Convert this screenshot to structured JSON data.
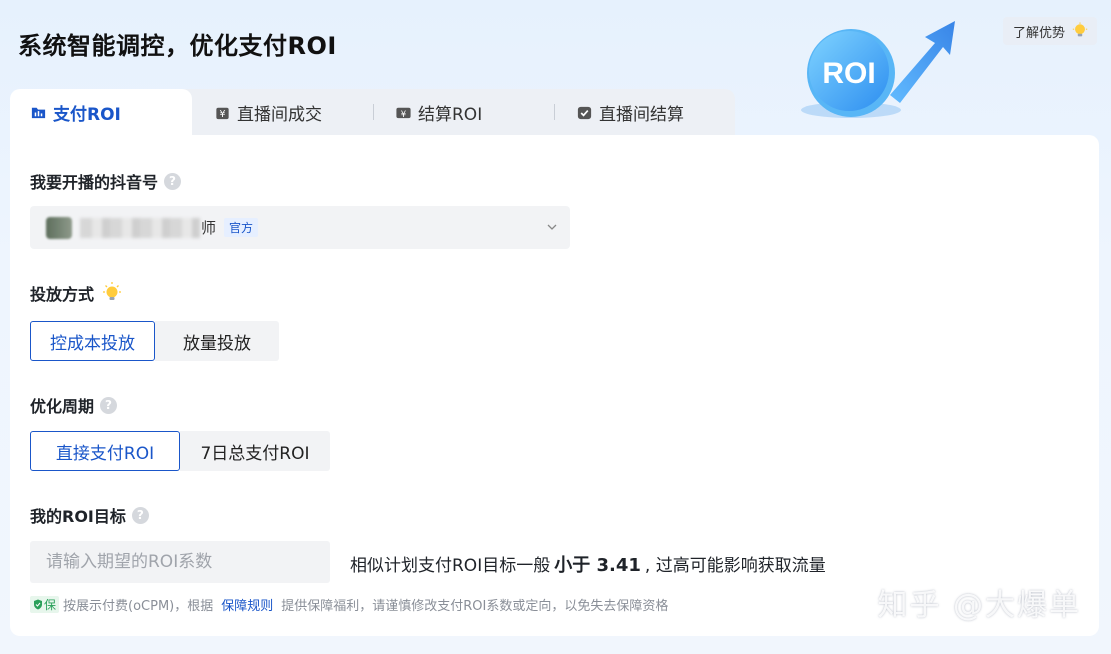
{
  "header": {
    "title": "系统智能调控，优化支付ROI",
    "learn_button": "了解优势",
    "deco_text": "ROI"
  },
  "tabs": [
    {
      "label": "支付ROI",
      "icon": "chart-icon",
      "active": true
    },
    {
      "label": "直播间成交",
      "icon": "bag-icon",
      "active": false
    },
    {
      "label": "结算ROI",
      "icon": "wallet-icon",
      "active": false
    },
    {
      "label": "直播间结算",
      "icon": "check-icon",
      "active": false
    }
  ],
  "account": {
    "label": "我要开播的抖音号",
    "name_suffix": "师",
    "official_tag": "官方"
  },
  "delivery": {
    "label": "投放方式",
    "options": [
      "控成本投放",
      "放量投放"
    ],
    "selected": "控成本投放"
  },
  "period": {
    "label": "优化周期",
    "options": [
      "直接支付ROI",
      "7日总支付ROI"
    ],
    "selected": "直接支付ROI"
  },
  "roi_target": {
    "label": "我的ROI目标",
    "placeholder": "请输入期望的ROI系数",
    "hint_prefix": "相似计划支付ROI目标一般",
    "hint_bold": "小于 3.41",
    "hint_suffix": ", 过高可能影响获取流量"
  },
  "notice": {
    "badge": "保",
    "text_before": "按展示付费(oCPM)，根据",
    "link": "保障规则",
    "text_after": "提供保障福利，请谨慎修改支付ROI系数或定向，以免失去保障资格"
  },
  "watermark": "知乎 @大爆单",
  "colors": {
    "accent": "#1a56c9",
    "background": "#e6f1fd",
    "notice_green": "#2aa05a"
  }
}
